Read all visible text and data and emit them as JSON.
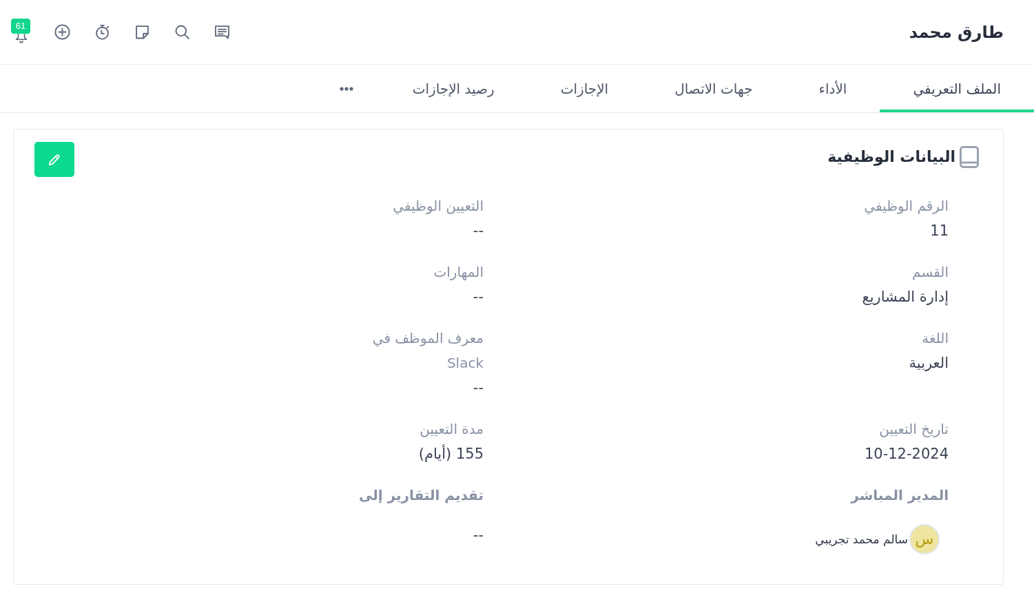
{
  "header": {
    "title": "طارق محمد",
    "notification_count": "61"
  },
  "tabs": [
    {
      "label": "الملف التعريفي",
      "selected": true
    },
    {
      "label": "الأداء",
      "selected": false
    },
    {
      "label": "جهات الاتصال",
      "selected": false
    },
    {
      "label": "الإجازات",
      "selected": false
    },
    {
      "label": "رصيد الإجازات",
      "selected": false
    }
  ],
  "job_details": {
    "title": "البيانات الوظيفية",
    "fields": [
      {
        "kind": "text",
        "label": "الرقم الوظيفي",
        "value": "11"
      },
      {
        "kind": "text",
        "label": "التعيين الوظيفي",
        "value": "--"
      },
      {
        "kind": "text",
        "label": "القسم",
        "value": "إدارة المشاريع"
      },
      {
        "kind": "text",
        "label": "المهارات",
        "value": "--"
      },
      {
        "kind": "text",
        "label": "اللغة",
        "value": "العربية"
      },
      {
        "kind": "text",
        "label": "معرف الموظف في\nSlack",
        "value": "--"
      },
      {
        "kind": "text",
        "label": "تاريخ التعيين",
        "value": "10-12-2024"
      },
      {
        "kind": "text",
        "label": "مدة التعيين",
        "value": "155 (أيام)"
      },
      {
        "kind": "relation",
        "label": "المدير المباشر",
        "person": {
          "initial": "س",
          "name": "سالم محمد تجريبي"
        }
      },
      {
        "kind": "relation",
        "label": "تقديم التقارير إلى",
        "value": "--"
      }
    ]
  }
}
